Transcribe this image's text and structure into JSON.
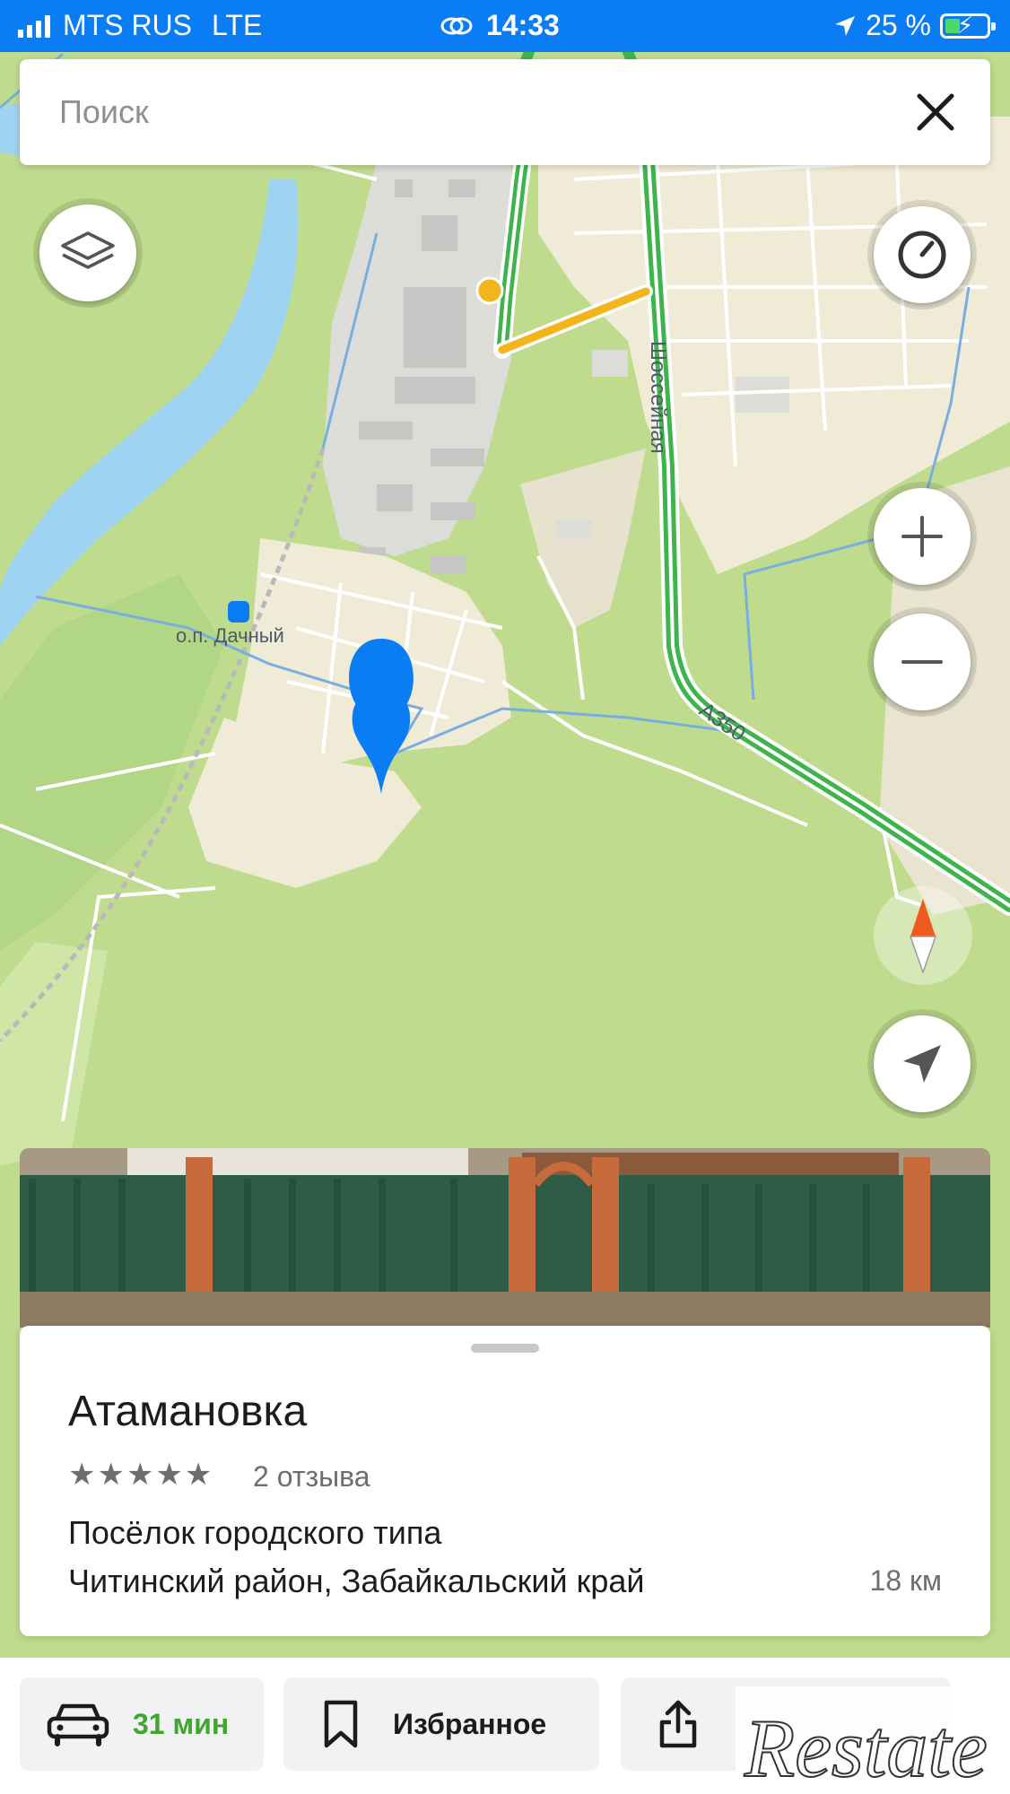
{
  "status_bar": {
    "carrier": "MTS RUS",
    "network": "LTE",
    "time": "14:33",
    "battery": "25 %"
  },
  "search": {
    "placeholder": "Поиск",
    "close_icon": "close-icon"
  },
  "map": {
    "labels": {
      "station": "о.п. Дачный",
      "street": "Шоссейная",
      "highway": "А350"
    },
    "controls": [
      "layers-icon",
      "traffic-icon",
      "zoom-in-icon",
      "zoom-out-icon",
      "compass-icon",
      "locate-icon"
    ],
    "colors": {
      "water": "#9fd3f2",
      "forest": "#bfdc8e",
      "settlement": "#efebd6",
      "industrial": "#dcdcd8",
      "road_green": "#3fb44c",
      "road_yellow": "#f3b51d",
      "pin": "#0a7df5"
    }
  },
  "place_card": {
    "title": "Атамановка",
    "stars": "★★★★★",
    "reviews": "2 отзыва",
    "type": "Посёлок городского типа",
    "address": "Читинский район, Забайкальский край",
    "distance": "18 км"
  },
  "bottom_bar": {
    "route_time": "31 мин",
    "favorite_label": "Избранное",
    "share_icon": "share-icon"
  },
  "watermark": "Restate"
}
